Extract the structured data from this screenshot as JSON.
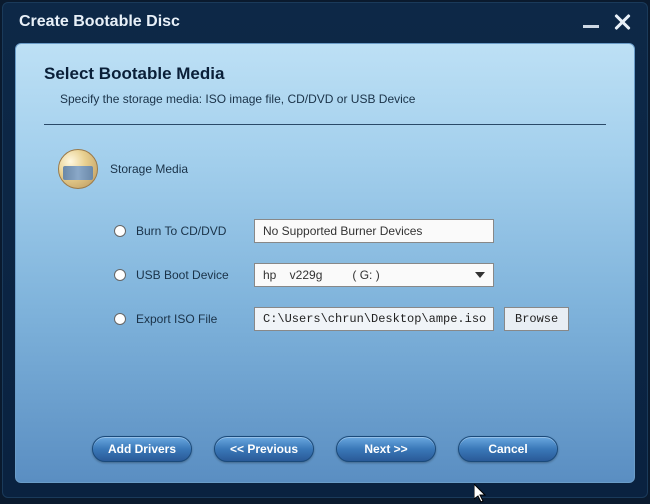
{
  "window": {
    "title": "Create Bootable Disc"
  },
  "page": {
    "heading": "Select Bootable Media",
    "subheading": "Specify the storage media: ISO image file, CD/DVD or USB Device"
  },
  "storage_section": {
    "label": "Storage Media"
  },
  "options": {
    "burn": {
      "label": "Burn To CD/DVD",
      "value": "No Supported Burner Devices"
    },
    "usb": {
      "label": "USB Boot Device",
      "value": "hp    v229g         ( G: )"
    },
    "iso": {
      "label": "Export ISO File",
      "value": "C:\\Users\\chrun\\Desktop\\ampe.iso",
      "browse": "Browse"
    }
  },
  "buttons": {
    "add_drivers": "Add Drivers",
    "previous": "<< Previous",
    "next": "Next >>",
    "cancel": "Cancel"
  }
}
